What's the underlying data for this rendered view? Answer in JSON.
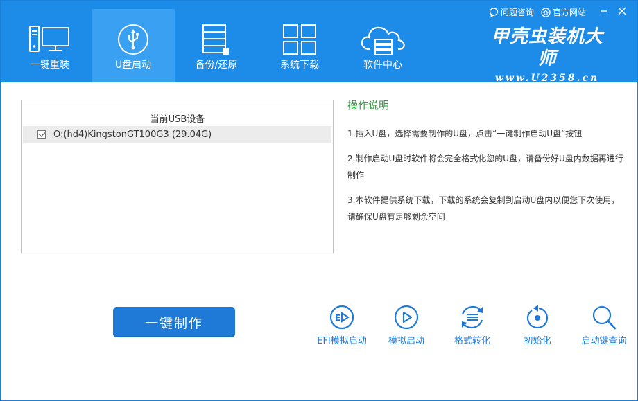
{
  "nav": {
    "items": [
      {
        "label": "一键重装",
        "icon": "monitor-icon",
        "active": false
      },
      {
        "label": "U盘启动",
        "icon": "usb-icon",
        "active": true
      },
      {
        "label": "备份/还原",
        "icon": "backup-icon",
        "active": false
      },
      {
        "label": "系统下载",
        "icon": "grid-icon",
        "active": false
      },
      {
        "label": "软件中心",
        "icon": "cloud-icon",
        "active": false
      }
    ]
  },
  "top_links": {
    "help": "问题咨询",
    "website": "官方网站"
  },
  "brand": {
    "name": "甲壳虫装机大师",
    "url": "www.U2358.cn"
  },
  "device_panel": {
    "title": "当前USB设备",
    "devices": [
      {
        "label": "O:(hd4)KingstonGT100G3 (29.04G)",
        "checked": true
      }
    ]
  },
  "instructions": {
    "title": "操作说明",
    "steps": [
      "1.插入U盘，选择需要制作的U盘，点击“一键制作启动U盘”按钮",
      "2.制作启动U盘时软件将会完全格式化您的U盘，请备份好U盘内数据再进行制作",
      "3.本软件提供系统下载，下载的系统会复制到启动U盘内以便您下次使用，请确保U盘有足够剩余空间"
    ]
  },
  "make_button": {
    "label": "一键制作"
  },
  "tools": [
    {
      "label": "EFI模拟启动",
      "icon": "efi-play-icon"
    },
    {
      "label": "模拟启动",
      "icon": "play-icon"
    },
    {
      "label": "格式转化",
      "icon": "convert-icon"
    },
    {
      "label": "初始化",
      "icon": "reset-icon"
    },
    {
      "label": "启动键查询",
      "icon": "search-icon"
    }
  ],
  "colors": {
    "header": "#1d8be8",
    "active_tab": "#3aa0f2",
    "accent": "#1e7ad6",
    "instruction_title": "#2e9e3e"
  }
}
